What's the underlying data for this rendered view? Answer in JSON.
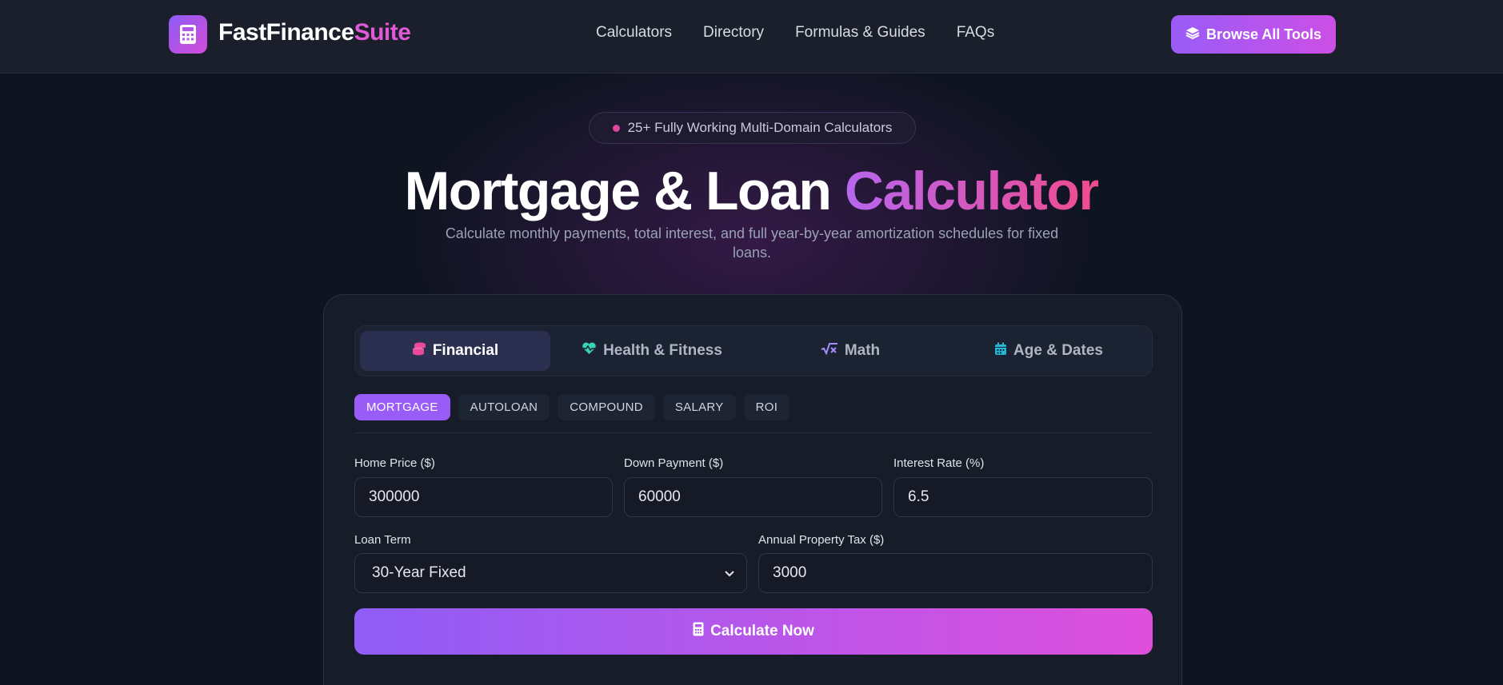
{
  "header": {
    "brand_part1": "FastFinance",
    "brand_part2": "Suite",
    "nav": [
      "Calculators",
      "Directory",
      "Formulas & Guides",
      "FAQs"
    ],
    "browse_label": "Browse All Tools"
  },
  "hero": {
    "pill_text": "25+ Fully Working Multi-Domain Calculators",
    "title_main": "Mortgage & Loan ",
    "title_accent": "Calculator",
    "subtitle": "Calculate monthly payments, total interest, and full year-by-year amortization schedules for fixed loans."
  },
  "category_tabs": [
    {
      "label": "Financial",
      "icon": "coins-icon",
      "active": true
    },
    {
      "label": "Health & Fitness",
      "icon": "heart-pulse-icon",
      "active": false
    },
    {
      "label": "Math",
      "icon": "square-root-icon",
      "active": false
    },
    {
      "label": "Age & Dates",
      "icon": "calendar-icon",
      "active": false
    }
  ],
  "sub_tabs": [
    "MORTGAGE",
    "AUTOLOAN",
    "COMPOUND",
    "SALARY",
    "ROI"
  ],
  "form": {
    "home_price_label": "Home Price ($)",
    "home_price_value": "300000",
    "down_payment_label": "Down Payment ($)",
    "down_payment_value": "60000",
    "interest_rate_label": "Interest Rate (%)",
    "interest_rate_value": "6.5",
    "loan_term_label": "Loan Term",
    "loan_term_value": "30-Year Fixed",
    "property_tax_label": "Annual Property Tax ($)",
    "property_tax_value": "3000",
    "calculate_label": "Calculate Now"
  },
  "colors": {
    "accent_purple": "#9a5cf7",
    "accent_pink": "#e05ad8",
    "teal_icon": "#3ad1b8"
  }
}
